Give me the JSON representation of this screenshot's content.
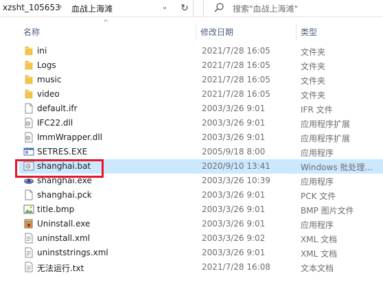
{
  "address": {
    "segment1": "xzsht_105653",
    "separator": "›",
    "segment2": "血战上海滩",
    "dropdown_icon": "chevron-down-icon",
    "refresh_icon": "refresh-icon"
  },
  "search": {
    "placeholder": "搜索\"血战上海滩\""
  },
  "columns": {
    "name": "名称",
    "date": "修改日期",
    "type": "类型",
    "sort_indicator": "^"
  },
  "colors": {
    "selection": "#cce8ff",
    "highlight_box": "#e3162a",
    "folder": "#f3c54a"
  },
  "files": [
    {
      "name": "ini",
      "date": "2021/7/28 16:05",
      "type": "文件夹",
      "icon": "folder-icon"
    },
    {
      "name": "Logs",
      "date": "2021/7/28 16:05",
      "type": "文件夹",
      "icon": "folder-icon"
    },
    {
      "name": "music",
      "date": "2021/7/28 16:05",
      "type": "文件夹",
      "icon": "folder-icon"
    },
    {
      "name": "video",
      "date": "2021/7/28 16:05",
      "type": "文件夹",
      "icon": "folder-icon"
    },
    {
      "name": "default.ifr",
      "date": "2003/3/26 9:01",
      "type": "IFR 文件",
      "icon": "file-icon"
    },
    {
      "name": "IFC22.dll",
      "date": "2003/3/26 9:01",
      "type": "应用程序扩展",
      "icon": "dll-icon"
    },
    {
      "name": "ImmWrapper.dll",
      "date": "2003/3/26 9:01",
      "type": "应用程序扩展",
      "icon": "dll-icon"
    },
    {
      "name": "SETRES.EXE",
      "date": "2005/9/18 8:00",
      "type": "应用程序",
      "icon": "exe-icon"
    },
    {
      "name": "shanghai.bat",
      "date": "2020/9/10 13:41",
      "type": "Windows 批处理...",
      "icon": "batch-icon",
      "selected": true
    },
    {
      "name": "shanghai.exe",
      "date": "2003/3/26 10:39",
      "type": "应用程序",
      "icon": "game-exe-icon"
    },
    {
      "name": "shanghai.pck",
      "date": "2003/3/26 9:01",
      "type": "PCK 文件",
      "icon": "file-icon"
    },
    {
      "name": "title.bmp",
      "date": "2003/3/26 9:01",
      "type": "BMP 图片文件",
      "icon": "bmp-icon"
    },
    {
      "name": "Uninstall.exe",
      "date": "2003/3/26 9:01",
      "type": "应用程序",
      "icon": "uninstall-icon"
    },
    {
      "name": "uninstall.xml",
      "date": "2003/3/26 9:02",
      "type": "XML 文档",
      "icon": "xml-icon"
    },
    {
      "name": "uninststrings.xml",
      "date": "2003/3/26 9:01",
      "type": "XML 文档",
      "icon": "xml-icon"
    },
    {
      "name": "无法运行.txt",
      "date": "2021/7/28 16:08",
      "type": "文本文档",
      "icon": "txt-icon"
    }
  ]
}
